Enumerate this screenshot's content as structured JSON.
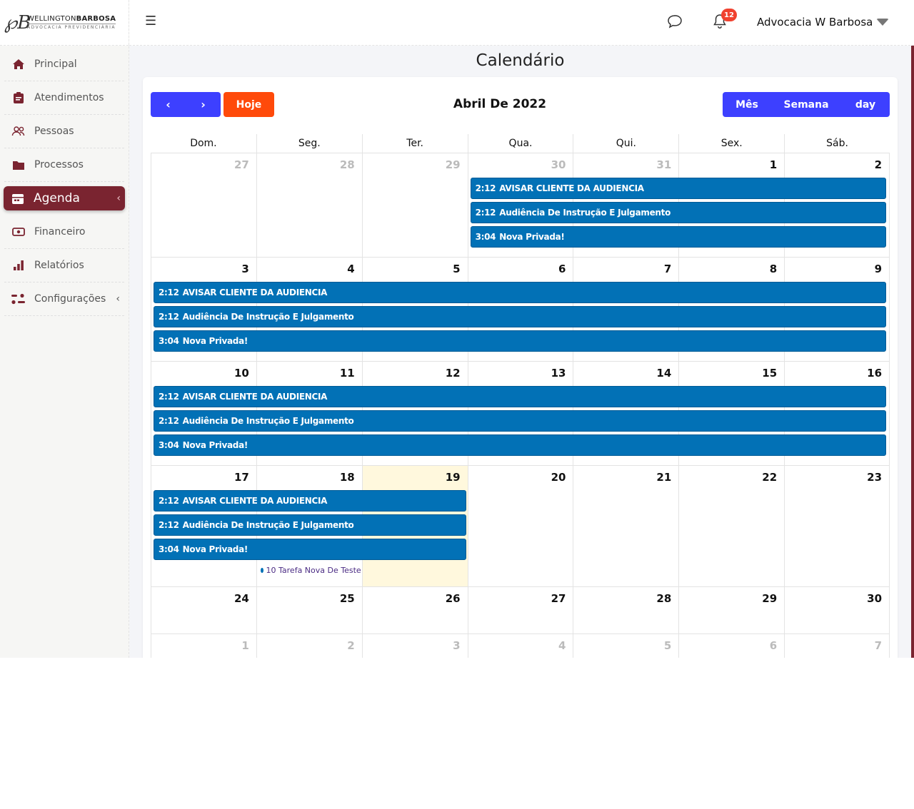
{
  "logo": {
    "mark": "℘B",
    "name_a": "WELLINGTON",
    "name_b": "BARBOSA",
    "tagline": "ADVOCACIA PREVIDENCIÁRIA"
  },
  "sidebar": {
    "items": [
      {
        "label": "Principal",
        "icon": "home-icon"
      },
      {
        "label": "Atendimentos",
        "icon": "clipboard-icon"
      },
      {
        "label": "Pessoas",
        "icon": "people-icon"
      },
      {
        "label": "Processos",
        "icon": "folder-icon"
      },
      {
        "label": "Agenda",
        "icon": "calendar-icon",
        "active": true
      },
      {
        "label": "Financeiro",
        "icon": "money-icon"
      },
      {
        "label": "Relatórios",
        "icon": "bar-chart-icon"
      },
      {
        "label": "Configurações",
        "icon": "sliders-icon"
      }
    ]
  },
  "topbar": {
    "notifications": "12",
    "user": "Advocacia W Barbosa"
  },
  "page_title": "Calendário",
  "calendar": {
    "prev": "‹",
    "next": "›",
    "today_label": "Hoje",
    "title": "Abril De 2022",
    "views": [
      "Mês",
      "Semana",
      "day"
    ],
    "dow": [
      "Dom.",
      "Seg.",
      "Ter.",
      "Qua.",
      "Qui.",
      "Sex.",
      "Sáb."
    ],
    "weeks": [
      [
        "27",
        "28",
        "29",
        "30",
        "31",
        "1",
        "2"
      ],
      [
        "3",
        "4",
        "5",
        "6",
        "7",
        "8",
        "9"
      ],
      [
        "10",
        "11",
        "12",
        "13",
        "14",
        "15",
        "16"
      ],
      [
        "17",
        "18",
        "19",
        "20",
        "21",
        "22",
        "23"
      ],
      [
        "24",
        "25",
        "26",
        "27",
        "28",
        "29",
        "30"
      ],
      [
        "1",
        "2",
        "3",
        "4",
        "5",
        "6",
        "7"
      ]
    ],
    "events": [
      {
        "time": "2:12",
        "title": "AVISAR CLIENTE DA AUDIENCIA"
      },
      {
        "time": "2:12",
        "title": "Audiência De Instrução E Julgamento"
      },
      {
        "time": "3:04",
        "title": "Nova Privada!"
      }
    ],
    "task": "10 Tarefa Nova De Teste"
  },
  "colors": {
    "brand": "#7a2430",
    "primary": "#3d40ff",
    "today_btn": "#ff4a0a",
    "event": "#0271b6"
  }
}
